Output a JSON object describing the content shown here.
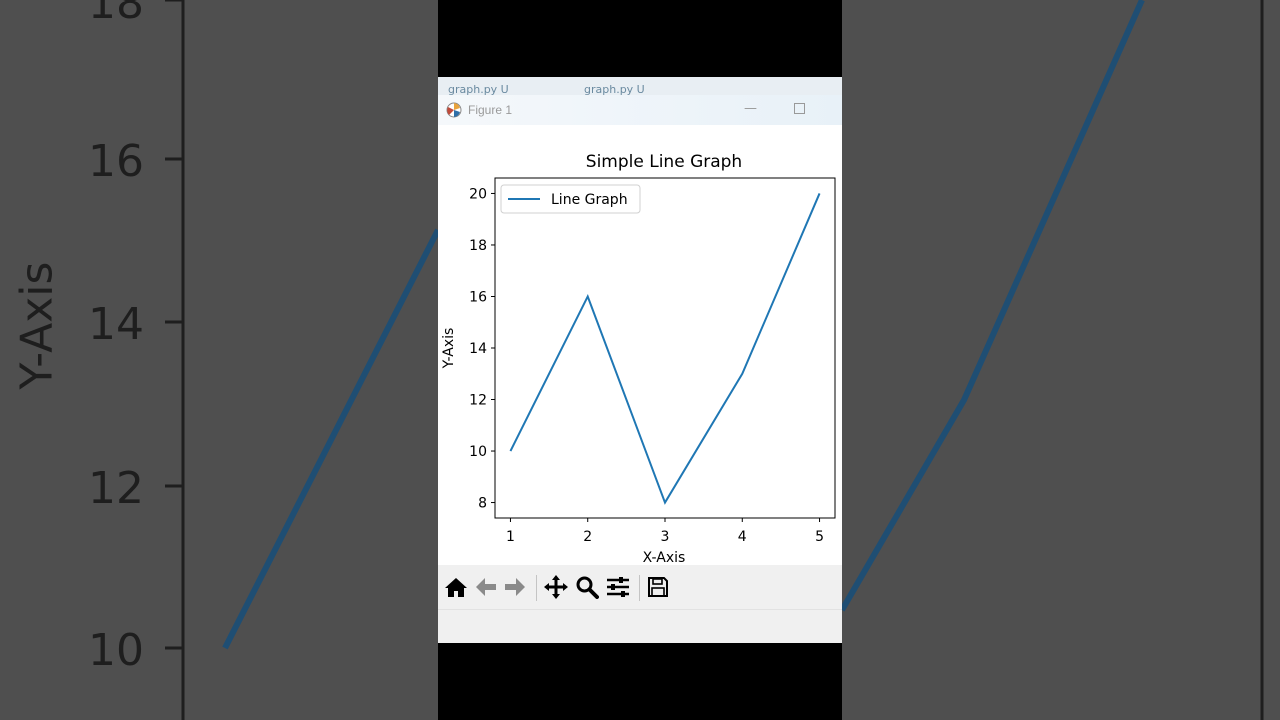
{
  "background": {
    "y_ticks": [
      "18",
      "16",
      "14",
      "12",
      "10"
    ],
    "ylabel": "Y-Axis",
    "line_color": "#1f4e73"
  },
  "editor": {
    "tabs": [
      "graph.py U",
      "graph.py U"
    ]
  },
  "window": {
    "title": "Figure 1"
  },
  "toolbar": {
    "buttons": [
      "home-icon",
      "back-arrow-icon",
      "forward-arrow-icon",
      "pan-icon",
      "zoom-icon",
      "configure-subplots-icon",
      "save-icon"
    ]
  },
  "chart_data": {
    "type": "line",
    "title": "Simple Line Graph",
    "xlabel": "X-Axis",
    "ylabel": "Y-Axis",
    "x": [
      1,
      2,
      3,
      4,
      5
    ],
    "series": [
      {
        "name": "Line Graph",
        "values": [
          10,
          16,
          8,
          13,
          20
        ],
        "color": "#1f77b4"
      }
    ],
    "xticks": [
      "1",
      "2",
      "3",
      "4",
      "5"
    ],
    "yticks": [
      "8",
      "10",
      "12",
      "14",
      "16",
      "18",
      "20"
    ],
    "xlim": [
      0.8,
      5.2
    ],
    "ylim": [
      7.4,
      20.6
    ],
    "legend": "upper-left",
    "grid": false
  }
}
